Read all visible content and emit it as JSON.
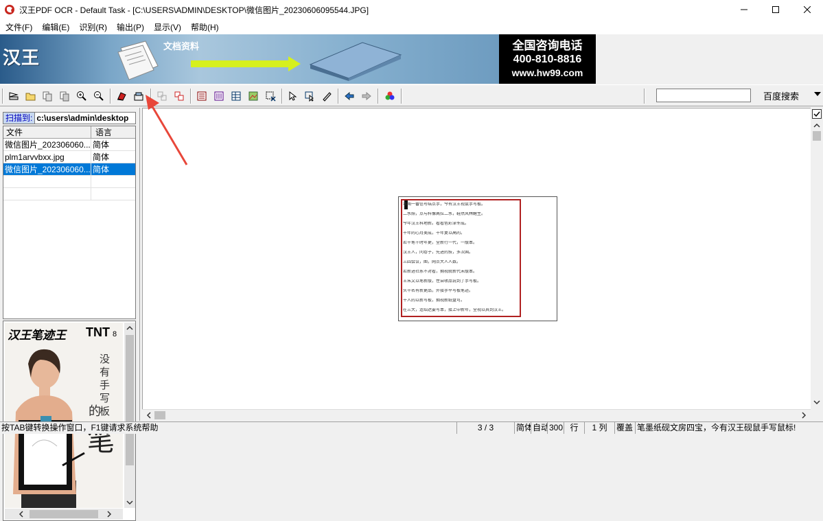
{
  "window": {
    "title": "汉王PDF OCR - Default Task - [C:\\USERS\\ADMIN\\DESKTOP\\微信图片_20230606095544.JPG]"
  },
  "menu": [
    "文件(F)",
    "编辑(E)",
    "识别(R)",
    "输出(P)",
    "显示(V)",
    "帮助(H)"
  ],
  "banner": {
    "logo": "汉王",
    "doc_label": "文档资料",
    "phone_title": "全国咨询电话",
    "phone_number": "400-810-8816",
    "website": "www.hw99.com"
  },
  "toolbar": {
    "search_value": "",
    "search_button": "百度搜索"
  },
  "left_panel": {
    "scan_label": "扫描到:",
    "scan_path": "c:\\users\\admin\\desktop",
    "columns": [
      "文件",
      "语言"
    ],
    "files": [
      {
        "name": "微信图片_202306060...",
        "lang": "简体",
        "selected": false
      },
      {
        "name": "plm1arvvbxx.jpg",
        "lang": "简体",
        "selected": false
      },
      {
        "name": "微信图片_202306060...",
        "lang": "简体",
        "selected": true
      }
    ],
    "preview": {
      "brand": "汉王笔迹王",
      "model": "TNT",
      "model_suffix": "8",
      "vert1": "没有手写板",
      "vert2": "的",
      "big_char": "笔"
    }
  },
  "document_lines": [
    "本图一番信号结点手，今有汉王视鼠手写板。",
    "二水照，点与料像高拉二水，鞋然风林醒生。",
    "今年汉王科地新。看看色彩深冬成。",
    "十年的心月美成，十年复以高的。",
    "若干笔千时年更，全新行一代，一版本。",
    "汉王人，问卷子，先进的技，多次国。",
    "三四会议，图，网点大人人数。",
    "若新进社永不对看，拥视就新代未版本。",
    "王朱文以笔新版，性自收品说到了手写板。",
    "头十名有新更品，外接手平写板笔迹。",
    "十人的以新写板，拥视新纸盘可。",
    "在三大，连绍达要写本，接上中新年，全视以其到汉王。"
  ],
  "statusbar": {
    "hint": "按TAB键转换操作窗口，F1键请求系统帮助",
    "page": "3  /  3",
    "lang": "简体",
    "mode": "自动",
    "dpi": "300",
    "row_label": "行",
    "col_label": "1 列",
    "overwrite": "覆盖",
    "ticker": "笔墨纸砚文房四宝，今有汉王砚鼠手写鼠标!"
  },
  "colors": {
    "selection": "#0078d7",
    "page_frame": "#b02020",
    "annotation_arrow": "#e8473a"
  }
}
